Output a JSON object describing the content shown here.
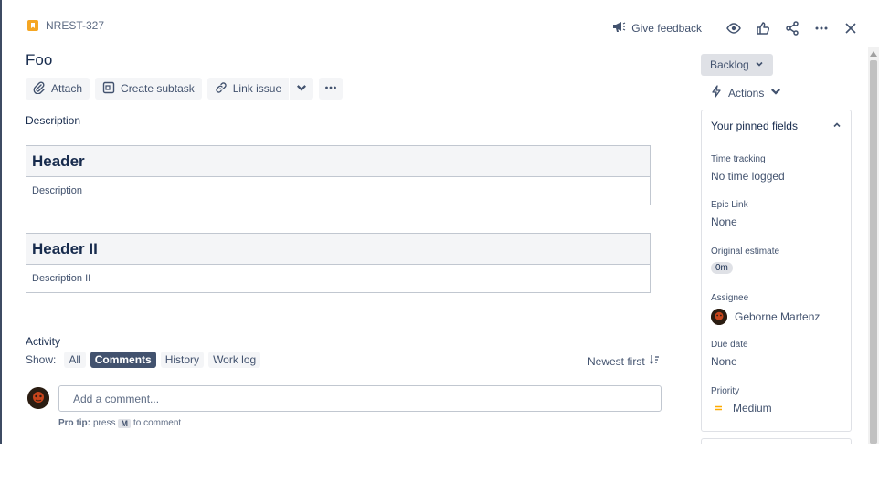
{
  "issue": {
    "key": "NREST-327",
    "title": "Foo"
  },
  "header": {
    "feedback_label": "Give feedback"
  },
  "toolbar": {
    "attach": "Attach",
    "create_subtask": "Create subtask",
    "link_issue": "Link issue"
  },
  "description": {
    "label": "Description",
    "tables": [
      {
        "header": "Header",
        "cell": "Description"
      },
      {
        "header": "Header II",
        "cell": "Description II"
      }
    ]
  },
  "activity": {
    "label": "Activity",
    "show_label": "Show:",
    "filters": [
      "All",
      "Comments",
      "History",
      "Work log"
    ],
    "active_filter": "Comments",
    "sort_label": "Newest first",
    "comment_placeholder": "Add a comment...",
    "protip_prefix": "Pro tip:",
    "protip_press": "press",
    "protip_key": "M",
    "protip_suffix": "to comment"
  },
  "sidebar": {
    "status": "Backlog",
    "actions_label": "Actions",
    "pinned_title": "Your pinned fields",
    "fields": {
      "time_tracking": {
        "label": "Time tracking",
        "value": "No time logged"
      },
      "epic_link": {
        "label": "Epic Link",
        "value": "None"
      },
      "original_estimate": {
        "label": "Original estimate",
        "value": "0m"
      },
      "assignee": {
        "label": "Assignee",
        "value": "Geborne Martenz"
      },
      "due_date": {
        "label": "Due date",
        "value": "None"
      },
      "priority": {
        "label": "Priority",
        "value": "Medium"
      }
    }
  },
  "colors": {
    "accent_dark": "#42526e",
    "priority_medium": "#ffab00",
    "issue_type": "#f5a623"
  }
}
